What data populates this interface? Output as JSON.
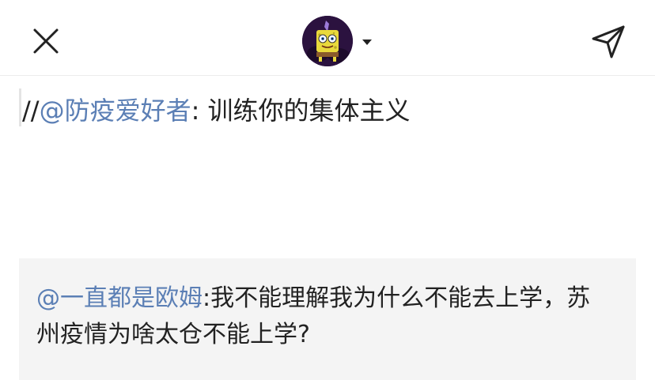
{
  "header": {
    "close_icon": "close-icon",
    "send_icon": "send-icon",
    "avatar_desc": "avatar"
  },
  "compose": {
    "prefix": "//",
    "mention": "@防疫爱好者",
    "text": ": 训练你的集体主义"
  },
  "quote": {
    "mention": "@一直都是欧姆",
    "text": ":我不能理解我为什么不能去上学，苏州疫情为啥太仓不能上学?"
  },
  "colors": {
    "mention": "#5b7fb5",
    "text": "#222222",
    "quote_bg": "#f4f4f4"
  }
}
